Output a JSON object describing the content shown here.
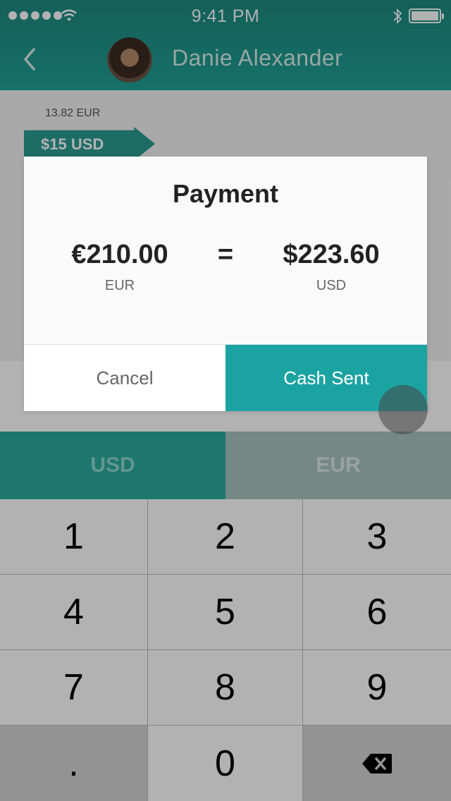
{
  "status_bar": {
    "time": "9:41 PM",
    "signal_icon": "signal-dots-icon",
    "wifi_icon": "wifi-icon",
    "bluetooth_icon": "bluetooth-icon",
    "battery_icon": "battery-icon"
  },
  "header": {
    "back_icon": "chevron-left-icon",
    "contact_name": "Danie Alexander",
    "avatar": "contact-avatar"
  },
  "transaction": {
    "converted_hint": "13.82 EUR",
    "amount_tag": "$15 USD"
  },
  "dialog": {
    "title": "Payment",
    "from": {
      "amount": "€210.00",
      "currency": "EUR"
    },
    "equals": "=",
    "to": {
      "amount": "$223.60",
      "currency": "USD"
    },
    "cancel_label": "Cancel",
    "confirm_label": "Cash Sent"
  },
  "currency_tabs": [
    {
      "label": "USD"
    },
    {
      "label": "EUR"
    }
  ],
  "keypad": {
    "keys": [
      "1",
      "2",
      "3",
      "4",
      "5",
      "6",
      "7",
      "8",
      "9",
      ".",
      "0"
    ],
    "backspace_icon": "backspace-icon"
  },
  "colors": {
    "accent": "#1ba3a1",
    "header": "#20a196",
    "tab_active": "#2aab9f"
  }
}
